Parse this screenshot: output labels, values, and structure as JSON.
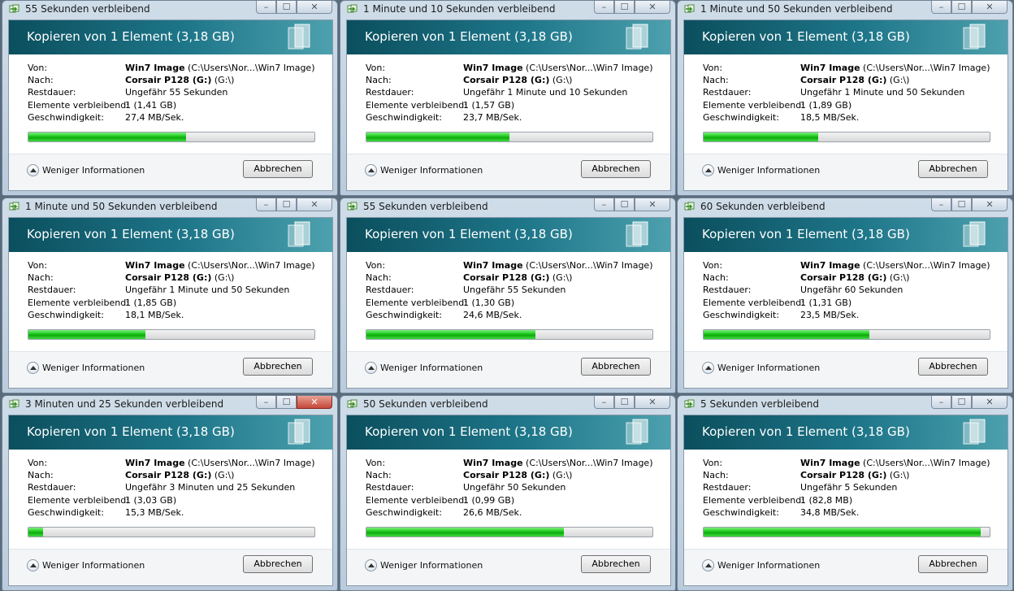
{
  "common": {
    "heading": "Kopieren von 1 Element (3,18 GB)",
    "labels": {
      "from": "Von:",
      "to": "Nach:",
      "remaining_time": "Restdauer:",
      "items_remaining": "Elemente verbleibend:",
      "speed": "Geschwindigkeit:"
    },
    "from_name": "Win7 Image",
    "from_path": "(C:\\Users\\Nor...\\Win7 Image)",
    "to_name": "Corsair P128 (G:)",
    "to_path": "(G:\\)",
    "less_info": "Weniger Informationen",
    "cancel": "Abbrechen"
  },
  "colors": {
    "progress": "#18c818",
    "banner": "#0b4f5e",
    "close_active": "#c4473a"
  },
  "icons": {
    "title": "copy-icon",
    "banner": "document-icon"
  },
  "dialogs": [
    {
      "title": "55 Sekunden verbleibend",
      "remaining": "Ungefähr 55 Sekunden",
      "items": "1 (1,41 GB)",
      "speed": "27,4 MB/Sek.",
      "progress": 0.55
    },
    {
      "title": "1 Minute und 10 Sekunden verbleibend",
      "remaining": "Ungefähr 1 Minute und 10 Sekunden",
      "items": "1 (1,57 GB)",
      "speed": "23,7 MB/Sek.",
      "progress": 0.5
    },
    {
      "title": "1 Minute und 50 Sekunden verbleibend",
      "remaining": "Ungefähr 1 Minute und 50 Sekunden",
      "items": "1 (1,89 GB)",
      "speed": "18,5 MB/Sek.",
      "progress": 0.4
    },
    {
      "title": "1 Minute und 50 Sekunden verbleibend",
      "remaining": "Ungefähr 1 Minute und 50 Sekunden",
      "items": "1 (1,85 GB)",
      "speed": "18,1 MB/Sek.",
      "progress": 0.41
    },
    {
      "title": "55 Sekunden verbleibend",
      "remaining": "Ungefähr 55 Sekunden",
      "items": "1 (1,30 GB)",
      "speed": "24,6 MB/Sek.",
      "progress": 0.59
    },
    {
      "title": "60 Sekunden verbleibend",
      "remaining": "Ungefähr 60 Sekunden",
      "items": "1 (1,31 GB)",
      "speed": "23,5 MB/Sek.",
      "progress": 0.58
    },
    {
      "title": "3 Minuten und 25 Sekunden verbleibend",
      "remaining": "Ungefähr 3 Minuten und 25 Sekunden",
      "items": "1 (3,03 GB)",
      "speed": "15,3 MB/Sek.",
      "progress": 0.05,
      "close_hover": true
    },
    {
      "title": "50 Sekunden verbleibend",
      "remaining": "Ungefähr 50 Sekunden",
      "items": "1 (0,99 GB)",
      "speed": "26,6 MB/Sek.",
      "progress": 0.69
    },
    {
      "title": "5 Sekunden verbleibend",
      "remaining": "Ungefähr 5 Sekunden",
      "items": "1 (82,8 MB)",
      "speed": "34,8 MB/Sek.",
      "progress": 0.97
    }
  ]
}
